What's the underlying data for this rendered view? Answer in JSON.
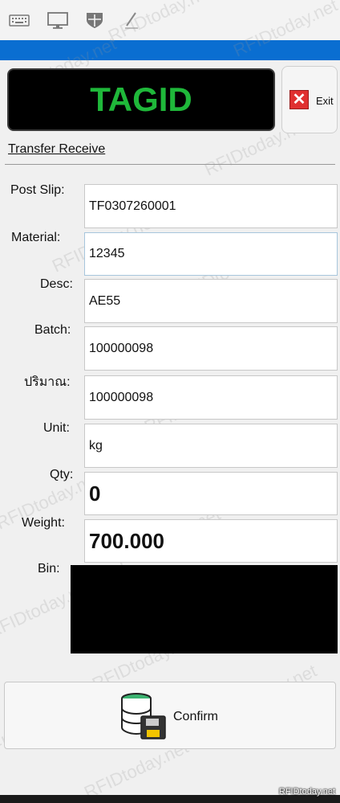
{
  "header": {
    "tagid": "TAGID",
    "exit_label": "Exit"
  },
  "section_title": "Transfer Receive",
  "fields": {
    "post_slip": {
      "label": "Post Slip:",
      "value": "TF0307260001"
    },
    "material": {
      "label": "Material:",
      "value": "12345"
    },
    "desc": {
      "label": "Desc:",
      "value": "AE55"
    },
    "batch": {
      "label": "Batch:",
      "value": "100000098"
    },
    "quantity_th": {
      "label": "ปริมาณ:",
      "value": "100000098"
    },
    "unit": {
      "label": "Unit:",
      "value": "kg"
    },
    "qty": {
      "label": "Qty:",
      "value": "0"
    },
    "weight": {
      "label": "Weight:",
      "value": "700.000"
    },
    "bin": {
      "label": "Bin:"
    }
  },
  "confirm_label": "Confirm",
  "watermark_text": "RFIDtoday.net",
  "credit": "RFIDtoday.net",
  "icons": [
    "keyboard-icon",
    "monitor-icon",
    "shield-icon",
    "pen-icon",
    "close-icon",
    "database-save-icon"
  ],
  "colors": {
    "accent_blue": "#0a6ed1",
    "tagid_green": "#1fb83a",
    "exit_red": "#e03030"
  }
}
